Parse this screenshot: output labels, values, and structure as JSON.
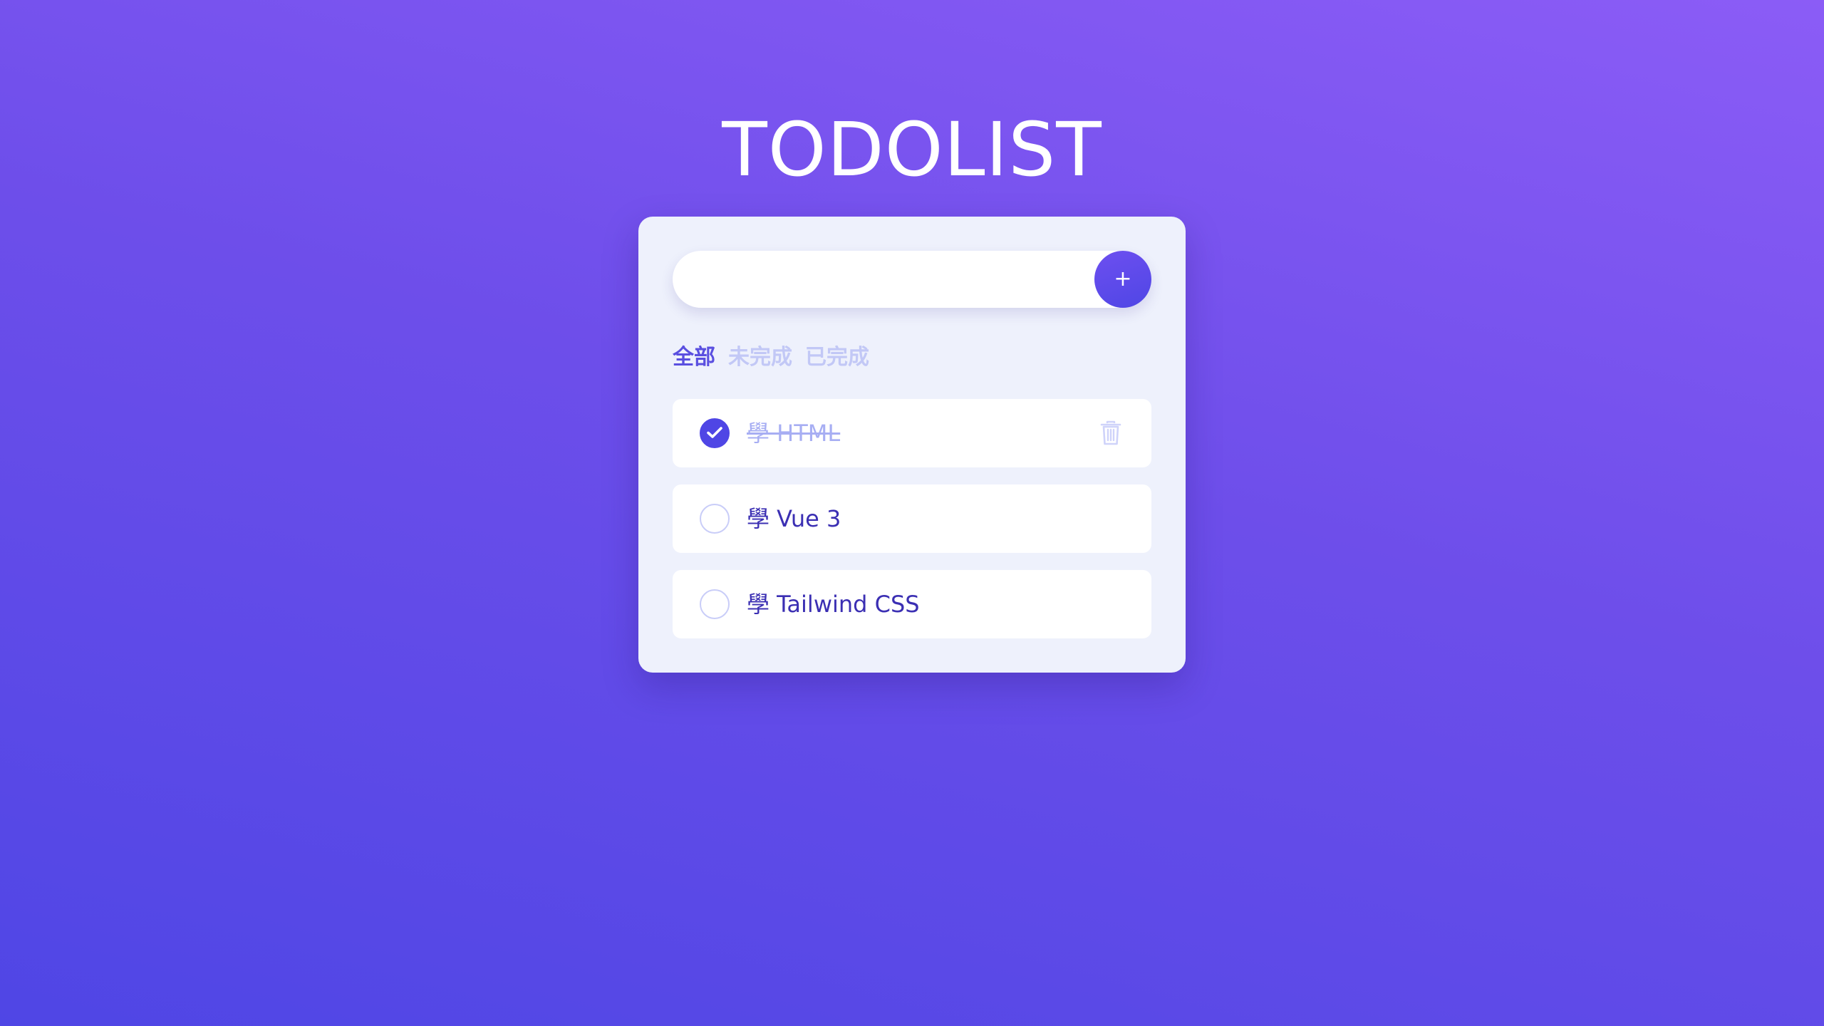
{
  "app": {
    "title": "TODOLIST"
  },
  "add_bar": {
    "input_value": "",
    "input_placeholder": "",
    "add_label": "+"
  },
  "tabs": [
    {
      "label": "全部",
      "active": true
    },
    {
      "label": "未完成",
      "active": false
    },
    {
      "label": "已完成",
      "active": false
    }
  ],
  "todos": [
    {
      "text": "學 HTML",
      "completed": true,
      "delete_icon": "trash-icon"
    },
    {
      "text": "學 Vue 3",
      "completed": false
    },
    {
      "text": "學 Tailwind CSS",
      "completed": false
    }
  ],
  "colors": {
    "accent": "#4f46e5",
    "text": "#3b2fb3",
    "muted": "#a7aef3",
    "card": "#eef1fc",
    "background_start": "#4f46e5",
    "background_end": "#8b5cf6"
  }
}
